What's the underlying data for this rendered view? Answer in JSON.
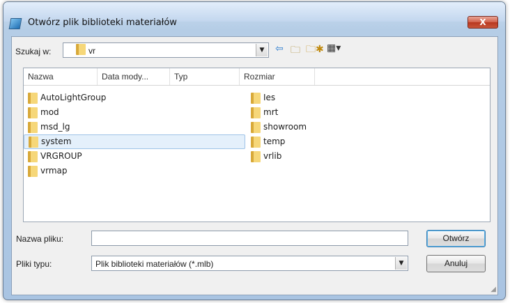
{
  "window": {
    "title": "Otwórz plik biblioteki materiałów",
    "close_label": "X"
  },
  "lookin": {
    "label": "Szukaj w:",
    "value": "vr"
  },
  "toolbar": {
    "back_icon": "back-arrow-icon",
    "up_icon": "up-folder-icon",
    "new_folder_icon": "new-folder-icon",
    "view_icon": "view-menu-icon"
  },
  "columns": [
    "Nazwa",
    "Data mody...",
    "Typ",
    "Rozmiar"
  ],
  "files": {
    "col1": [
      "AutoLightGroup",
      "mod",
      "msd_lg",
      "system",
      "VRGROUP",
      "vrmap"
    ],
    "col2": [
      "Ies",
      "mrt",
      "showroom",
      "temp",
      "vrlib"
    ]
  },
  "filename": {
    "label": "Nazwa pliku:",
    "value": ""
  },
  "filetype": {
    "label": "Pliki typu:",
    "value": "Plik biblioteki materiałów (*.mlb)"
  },
  "buttons": {
    "open": "Otwórz",
    "cancel": "Anuluj"
  },
  "colors": {
    "selection": "#e4f0fb",
    "titlebar": "#c9dcef",
    "close": "#c8553a"
  }
}
